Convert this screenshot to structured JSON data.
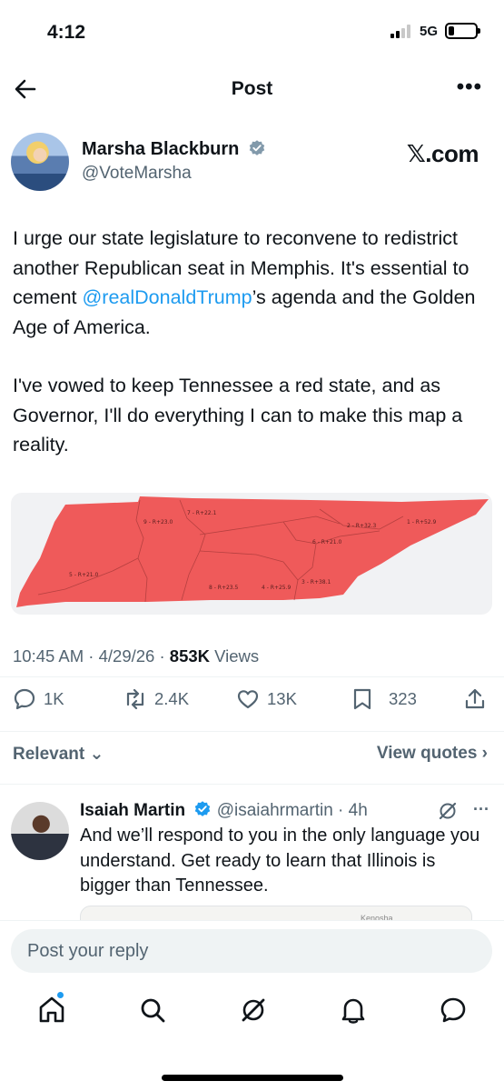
{
  "status_bar": {
    "time": "4:12",
    "network": "5G"
  },
  "header": {
    "title": "Post"
  },
  "post": {
    "author_name": "Marsha Blackburn",
    "author_handle": "@VoteMarsha",
    "source_badge": "𝕏.com",
    "text_part1": "I urge our state legislature to reconvene to redistrict another Republican seat in Memphis. It's essential to cement ",
    "mention": "@realDonaldTrump",
    "text_part2": "’s agenda and the Golden Age of America.",
    "paragraph2": "I've vowed to keep Tennessee a red state, and as Governor, I'll do everything I can to make this map a reality.",
    "timestamp": "10:45 AM · 4/29/26 · ",
    "views_count": "853K",
    "views_label": " Views",
    "map_labels": [
      {
        "id": "9",
        "text": "9 - R+23.0"
      },
      {
        "id": "7",
        "text": "7 - R+22.1"
      },
      {
        "id": "2",
        "text": "2 - R+32.3"
      },
      {
        "id": "1",
        "text": "1 - R+52.9"
      },
      {
        "id": "6",
        "text": "6 - R+21.0"
      },
      {
        "id": "5",
        "text": "5 - R+21.0"
      },
      {
        "id": "8",
        "text": "8 - R+23.5"
      },
      {
        "id": "4",
        "text": "4 - R+25.9"
      },
      {
        "id": "3",
        "text": "3 - R+38.1"
      }
    ],
    "map_color": "#ef5a5a"
  },
  "actions": {
    "replies": "1K",
    "reposts": "2.4K",
    "likes": "13K",
    "bookmarks": "323"
  },
  "sort": {
    "relevant": "Relevant",
    "view_quotes": "View quotes"
  },
  "reply": {
    "author_name": "Isaiah Martin",
    "author_handle": "@isaiahrmartin",
    "time": " · 4h",
    "text": "And we’ll respond to you in the only language you understand. Get ready to learn that Illinois is bigger than Tennessee.",
    "media_text": "Kenosha"
  },
  "composer": {
    "placeholder": "Post your reply"
  },
  "colors": {
    "accent": "#1d9bf0",
    "muted": "#536471",
    "text": "#0f1419"
  }
}
